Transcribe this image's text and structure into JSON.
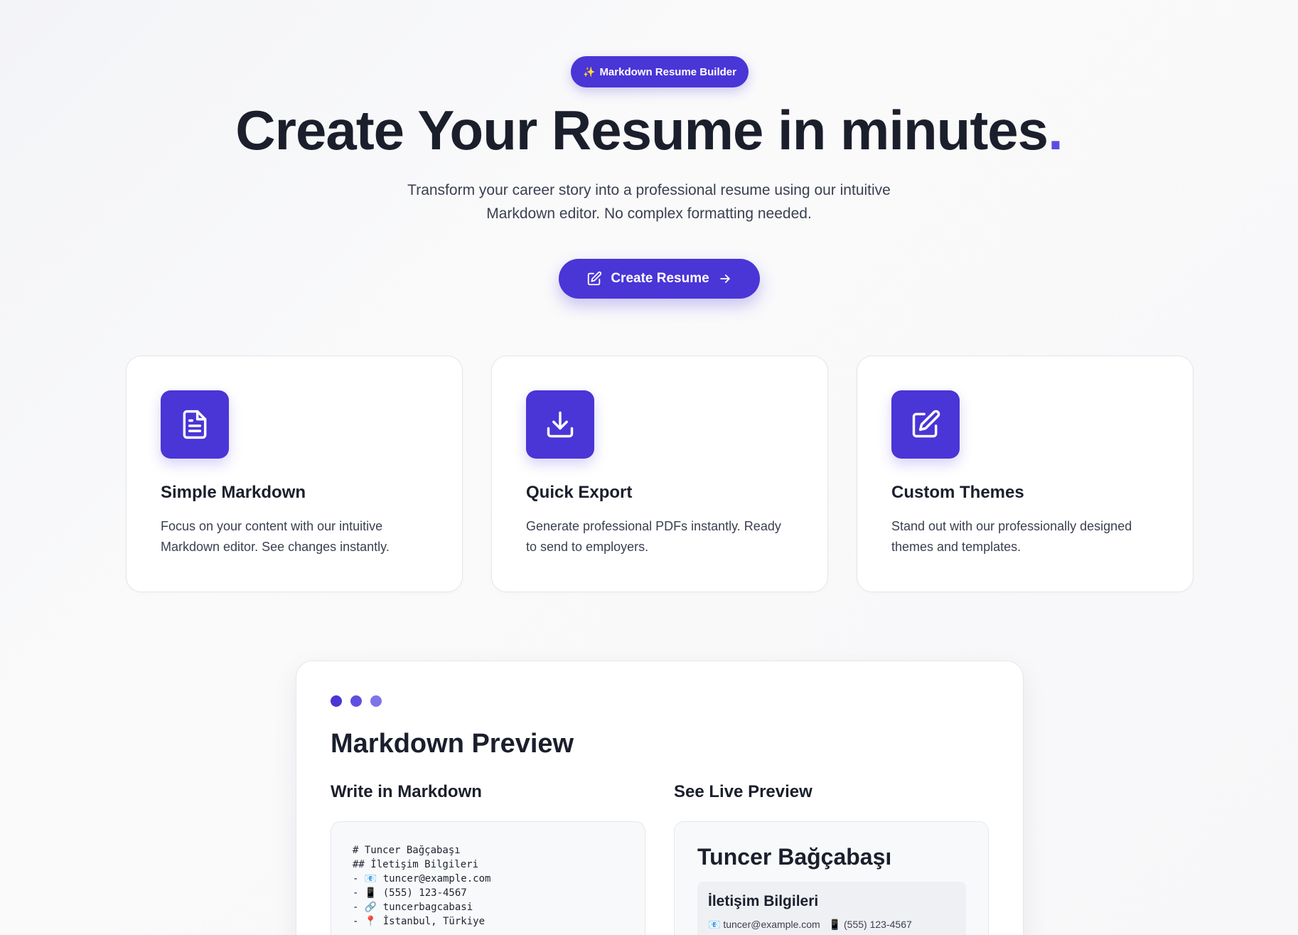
{
  "hero": {
    "badge_icon": "sparkles-icon",
    "badge_glyph": "✨",
    "badge_label": "Markdown Resume Builder",
    "title": "Create Your Resume in minutes",
    "title_dot": ".",
    "subtitle_line1": "Transform your career story into a professional resume using our intuitive",
    "subtitle_line2": "Markdown editor. No complex formatting needed.",
    "cta_label": "Create Resume",
    "cta_icon_left": "edit-icon",
    "cta_icon_right": "arrow-right-icon"
  },
  "features": [
    {
      "icon": "file-text-icon",
      "title": "Simple Markdown",
      "line1": "Focus on your content with our intuitive",
      "line2": "Markdown editor. See changes instantly."
    },
    {
      "icon": "download-icon",
      "title": "Quick Export",
      "line1": "Generate professional PDFs instantly. Ready",
      "line2": "to send to employers."
    },
    {
      "icon": "edit-icon",
      "title": "Custom Themes",
      "line1": "Stand out with our professionally designed",
      "line2": "themes and templates."
    }
  ],
  "preview": {
    "title": "Markdown Preview",
    "dot_colors": [
      "#4a35d6",
      "#5f4fe0",
      "#7e74e8"
    ],
    "left_title": "Write in Markdown",
    "right_title": "See Live Preview",
    "code_lines": [
      "# Tuncer Bağçabaşı",
      "## İletişim Bilgileri",
      "- 📧 tuncer@example.com",
      "- 📱 (555) 123-4567",
      "- 🔗 tuncerbagcabasi",
      "- 📍 İstanbul, Türkiye"
    ],
    "live_name": "Tuncer Bağçabaşı",
    "live_section_title": "İletişim Bilgileri",
    "live_email": "📧 tuncer@example.com",
    "live_phone": "📱 (555) 123-4567"
  },
  "colors": {
    "accent": "#4a35d6",
    "title_dot": "#5a4de6",
    "text": "#1b1f2c"
  }
}
